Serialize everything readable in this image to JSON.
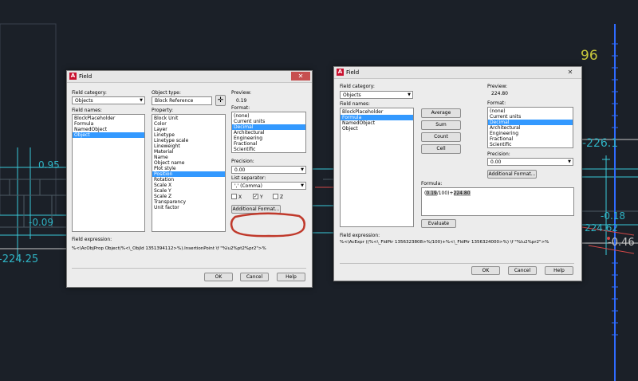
{
  "background": {
    "texts": [
      "0.95",
      "-0.09",
      "-224.25",
      "96",
      "-226.1",
      "-0.18",
      "224.62",
      "-0.46"
    ]
  },
  "left_dialog": {
    "title": "Field",
    "close": "✕",
    "field_category_label": "Field category:",
    "field_category_value": "Objects",
    "field_names_label": "Field names:",
    "field_names": [
      "BlockPlaceholder",
      "Formula",
      "NamedObject",
      "Object"
    ],
    "object_type_label": "Object type:",
    "object_type_value": "Block Reference",
    "property_label": "Property:",
    "properties": [
      "Block Unit",
      "Color",
      "Layer",
      "Linetype",
      "Linetype scale",
      "Lineweight",
      "Material",
      "Name",
      "Object name",
      "Plot style",
      "Position",
      "Rotation",
      "Scale X",
      "Scale Y",
      "Scale Z",
      "Transparency",
      "Unit factor"
    ],
    "preview_label": "Preview:",
    "preview_value": "0.19",
    "format_label": "Format:",
    "formats": [
      "(none)",
      "Current units",
      "Decimal",
      "Architectural",
      "Engineering",
      "Fractional",
      "Scientific"
    ],
    "precision_label": "Precision:",
    "precision_value": "0.00",
    "list_separator_label": "List separator:",
    "list_separator_value": "',' (Comma)",
    "x_label": "X",
    "y_label": "Y",
    "z_label": "Z",
    "additional_format": "Additional Format...",
    "field_expression_label": "Field expression:",
    "field_expression": "%<\\AcObjProp Object(%<\\_ObjId 1351394112>%).InsertionPoint \\f \"%lu2%pt2%pr2\">%",
    "ok": "OK",
    "cancel": "Cancel",
    "help": "Help"
  },
  "right_dialog": {
    "title": "Field",
    "close": "✕",
    "field_category_label": "Field category:",
    "field_category_value": "Objects",
    "field_names_label": "Field names:",
    "field_names": [
      "BlockPlaceholder",
      "Formula",
      "NamedObject",
      "Object"
    ],
    "average": "Average",
    "sum": "Sum",
    "count": "Count",
    "cell": "Cell",
    "preview_label": "Preview:",
    "preview_value": "224.80",
    "format_label": "Format:",
    "formats": [
      "(none)",
      "Current units",
      "Decimal",
      "Architectural",
      "Engineering",
      "Fractional",
      "Scientific"
    ],
    "precision_label": "Precision:",
    "precision_value": "0.00",
    "additional_format": "Additional Format...",
    "formula_label": "Formula:",
    "formula_part1": "0.19",
    "formula_part2": "/100)+",
    "formula_part3": "224.80",
    "evaluate": "Evaluate",
    "field_expression_label": "Field expression:",
    "field_expression": "%<\\AcExpr ((%<\\_FldPtr 1356323808>%/100)+%<\\_FldPtr 1356324000>%) \\f \"%lu2%pr2\">%",
    "ok": "OK",
    "cancel": "Cancel",
    "help": "Help"
  },
  "colors": {
    "cad_background": "#1b2028",
    "cyan": "#2fb3c4",
    "selection": "#3399ff",
    "annotation_red": "#c0392b"
  }
}
